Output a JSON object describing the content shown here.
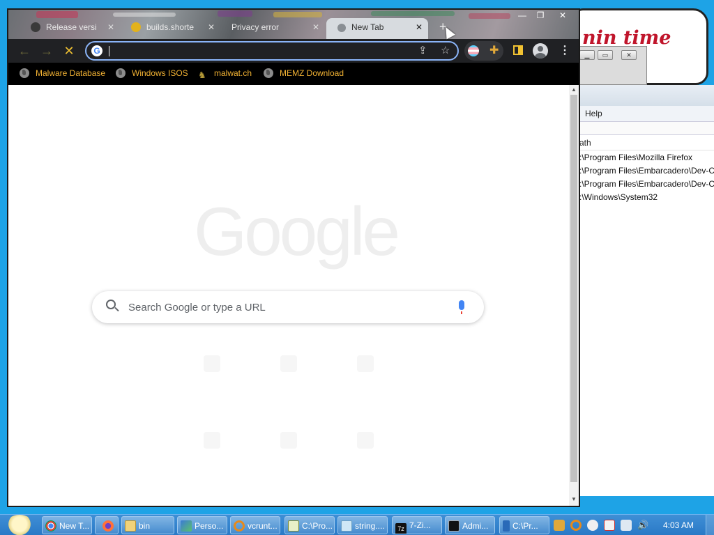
{
  "background": {
    "popup_text": "nin time",
    "explorer": {
      "menu_label": "Help",
      "column_header": "ath",
      "paths": [
        ":\\Program Files\\Mozilla Firefox",
        ":\\Program Files\\Embarcadero\\Dev-C",
        ":\\Program Files\\Embarcadero\\Dev-C",
        ":\\Windows\\System32"
      ]
    }
  },
  "browser": {
    "tabs": [
      {
        "label": "Release versi",
        "active": false
      },
      {
        "label": "builds.shorte",
        "active": false
      },
      {
        "label": "Privacy error",
        "active": false
      },
      {
        "label": "New Tab",
        "active": true
      }
    ],
    "new_tab_glyph": "+",
    "caption": {
      "minimize": "—",
      "maximize": "❐",
      "close": "✕"
    },
    "omnibox": {
      "value": "",
      "favicon": "G"
    },
    "bookmarks": [
      {
        "label": "Malware Database",
        "icon": "globe-icon"
      },
      {
        "label": "Windows ISOS",
        "icon": "globe-icon"
      },
      {
        "label": "malwat.ch",
        "icon": "figure-icon"
      },
      {
        "label": "MEMZ Download",
        "icon": "globe-icon"
      }
    ],
    "new_tab_page": {
      "logo_text": "Google",
      "search_placeholder": "Search Google or type a URL"
    },
    "accent_color": "#8ab4f8",
    "bookmark_color": "#f2b233"
  },
  "taskbar": {
    "items": [
      {
        "label": "New T...",
        "icon": "chrome-icon"
      },
      {
        "label": "",
        "icon": "firefox-icon"
      },
      {
        "label": "bin",
        "icon": "folder-icon"
      },
      {
        "label": "Perso...",
        "icon": "personalize-icon"
      },
      {
        "label": "vcrunt...",
        "icon": "search-file-icon"
      },
      {
        "label": "C:\\Pro...",
        "icon": "editor-icon"
      },
      {
        "label": "string....",
        "icon": "notepad-icon"
      },
      {
        "label": "7-Zi...",
        "icon": "7zip-icon"
      },
      {
        "label": "Admi...",
        "icon": "cmd-icon"
      },
      {
        "label": "C:\\Pr...",
        "icon": "device-icon"
      }
    ],
    "clock": "4:03 AM"
  }
}
